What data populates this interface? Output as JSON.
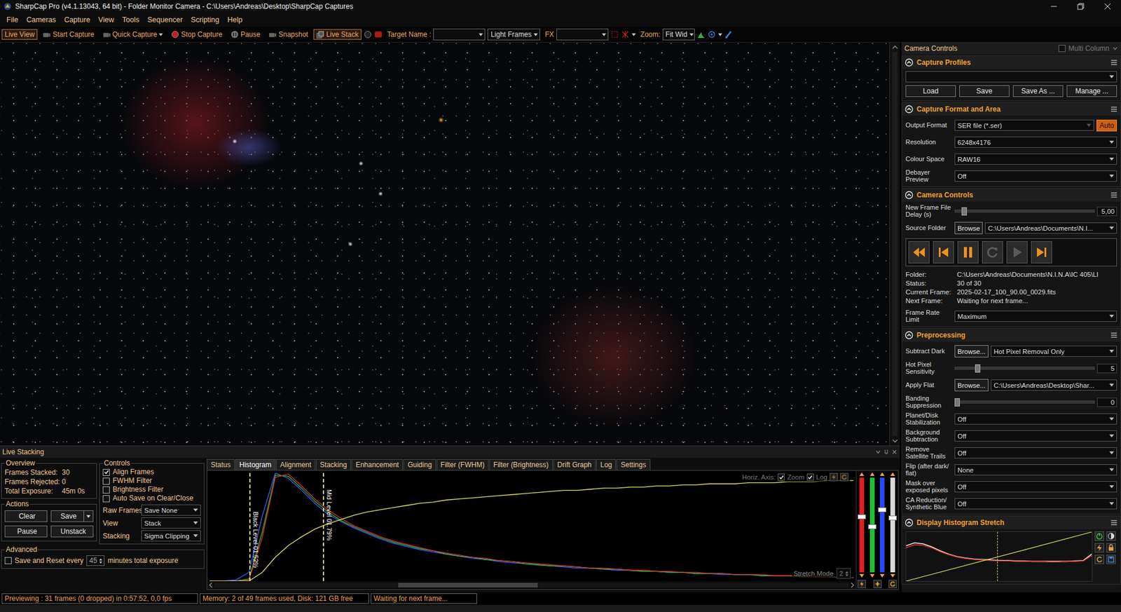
{
  "window": {
    "title": "SharpCap Pro (v4.1.13043, 64 bit) - Folder Monitor Camera - C:\\Users\\Andreas\\Desktop\\SharpCap Captures"
  },
  "menu": [
    "File",
    "Cameras",
    "Capture",
    "View",
    "Tools",
    "Sequencer",
    "Scripting",
    "Help"
  ],
  "toolbar": {
    "buttons": [
      {
        "label": "Live View",
        "selected": true,
        "dropdown": false
      },
      {
        "label": "Start Capture",
        "selected": false,
        "dropdown": false
      },
      {
        "label": "Quick Capture",
        "selected": false,
        "dropdown": true
      },
      {
        "label": "Stop Capture",
        "selected": false,
        "dropdown": false
      },
      {
        "label": "Pause",
        "selected": false,
        "dropdown": false
      },
      {
        "label": "Snapshot",
        "selected": false,
        "dropdown": false
      },
      {
        "label": "Live Stack",
        "selected": true,
        "dropdown": false
      }
    ],
    "target_name": {
      "label": "Target Name :",
      "value": ""
    },
    "frame_type": {
      "value": "Light Frames"
    },
    "fx": {
      "label": "FX",
      "value": ""
    },
    "zoom": {
      "label": "Zoom:",
      "value": "Fit Wid"
    }
  },
  "right_panel": {
    "title": "Camera Controls",
    "multi_column": {
      "label": "Multi Column",
      "checked": false
    },
    "capture_profiles": {
      "title": "Capture Profiles",
      "expanded": true,
      "profile": "",
      "buttons": [
        "Load",
        "Save",
        "Save As ...",
        "Manage ..."
      ]
    },
    "capture_format": {
      "title": "Capture Format and Area",
      "expanded": true,
      "rows": [
        {
          "label": "Output Format",
          "value": "SER file (*.ser)",
          "disabled": true,
          "extra": "Auto"
        },
        {
          "label": "Resolution",
          "value": "6248x4176",
          "disabled": false,
          "extra": ""
        },
        {
          "label": "Colour Space",
          "value": "RAW16",
          "disabled": false,
          "extra": ""
        },
        {
          "label": "Debayer Preview",
          "value": "Off",
          "disabled": false,
          "extra": ""
        }
      ]
    },
    "camera_controls": {
      "title": "Camera Controls",
      "expanded": true,
      "delay": {
        "label": "New Frame File Delay (s)",
        "level": 0.05,
        "value": "5,00"
      },
      "source_folder": {
        "label": "Source Folder",
        "button": "Browse",
        "value": "C:\\Users\\Andreas\\Documents\\N.I..."
      },
      "media_buttons": [
        {
          "disabled": false
        },
        {
          "disabled": false
        },
        {
          "disabled": false
        },
        {
          "disabled": true
        },
        {
          "disabled": true
        },
        {
          "disabled": false
        }
      ],
      "info": [
        {
          "label": "Folder:",
          "value": "C:\\Users\\Andreas\\Documents\\N.I.N.A\\IC 405\\LI"
        },
        {
          "label": "Status:",
          "value": "30 of 30"
        },
        {
          "label": "Current Frame:",
          "value": "2025-02-17_100_90.00_0029.fits"
        },
        {
          "label": "Next Frame:",
          "value": "Waiting for next frame..."
        }
      ],
      "frame_rate": {
        "label": "Frame Rate Limit",
        "value": "Maximum"
      }
    },
    "preprocessing": {
      "title": "Preprocessing",
      "expanded": true,
      "rows": [
        {
          "kind": "browse",
          "label": "Subtract Dark",
          "button": "Browse...",
          "value": "Hot Pixel Removal Only"
        },
        {
          "kind": "slider",
          "label": "Hot Pixel Sensitivity",
          "level": 0.15,
          "value": "5"
        },
        {
          "kind": "browse",
          "label": "Apply Flat",
          "button": "Browse...",
          "value": "C:\\Users\\Andreas\\Desktop\\Shar..."
        },
        {
          "kind": "slider",
          "label": "Banding Suppression",
          "level": 0,
          "value": "0"
        },
        {
          "kind": "select",
          "label": "Planet/Disk Stabilization",
          "value": "Off"
        },
        {
          "kind": "select",
          "label": "Background Subtraction",
          "value": "Off"
        },
        {
          "kind": "select",
          "label": "Remove Satellite Trails",
          "value": "Off"
        },
        {
          "kind": "select",
          "label": "Flip (after dark/ flat)",
          "value": "None"
        },
        {
          "kind": "select",
          "label": "Mask over exposed pixels",
          "value": "Off"
        },
        {
          "kind": "select",
          "label": "CA Reduction/ Synthetic Blue",
          "value": "Off"
        }
      ]
    },
    "display_stretch": {
      "title": "Display Histogram Stretch",
      "expanded": true,
      "series": [
        {
          "name": "Luminance",
          "color": "#f0f0f0",
          "values": [
            72,
            78,
            76,
            70,
            62,
            55,
            50,
            47,
            45,
            44,
            43,
            42,
            42,
            41,
            41,
            40,
            40,
            40,
            40,
            40,
            41,
            42,
            55
          ]
        },
        {
          "name": "Red",
          "color": "#e03030",
          "values": [
            68,
            74,
            73,
            68,
            60,
            54,
            49,
            46,
            44,
            43,
            42,
            41,
            41,
            40,
            40,
            40,
            40,
            39,
            39,
            40,
            40,
            41,
            52
          ]
        }
      ],
      "transfer": [
        0,
        100
      ],
      "mid_marker": {
        "level": 0.49
      }
    }
  },
  "live_stacking": {
    "title": "Live Stacking",
    "overview": {
      "title": "Overview",
      "items": [
        {
          "label": "Frames Stacked:",
          "value": "30"
        },
        {
          "label": "Frames Rejected:",
          "value": "0"
        },
        {
          "label": "Total Exposure:",
          "value": "45m 0s"
        }
      ]
    },
    "actions": {
      "title": "Actions",
      "buttons": [
        {
          "label": "Clear",
          "dropdown": false
        },
        {
          "label": "Save",
          "dropdown": true
        },
        {
          "label": "Pause",
          "dropdown": false
        },
        {
          "label": "Unstack",
          "dropdown": false
        }
      ]
    },
    "advanced": {
      "title": "Advanced",
      "label": "Save and Reset every",
      "checked": false,
      "value": "45",
      "suffix": "minutes total exposure"
    },
    "controls": {
      "title": "Controls",
      "checkboxes": [
        {
          "label": "Align Frames",
          "checked": true
        },
        {
          "label": "FWHM Filter",
          "checked": false
        },
        {
          "label": "Brightness Filter",
          "checked": false
        },
        {
          "label": "Auto Save on Clear/Close",
          "checked": false
        }
      ],
      "selects": [
        {
          "label": "Raw Frames",
          "value": "Save None"
        },
        {
          "label": "View",
          "value": "Stack"
        },
        {
          "label": "Stacking",
          "value": "Sigma Clipping"
        }
      ]
    },
    "tabs": [
      {
        "label": "Status",
        "selected": false
      },
      {
        "label": "Histogram",
        "selected": true
      },
      {
        "label": "Alignment",
        "selected": false
      },
      {
        "label": "Stacking",
        "selected": false
      },
      {
        "label": "Enhancement",
        "selected": false
      },
      {
        "label": "Guiding",
        "selected": false
      },
      {
        "label": "Filter (FWHM)",
        "selected": false
      },
      {
        "label": "Filter (Brightness)",
        "selected": false
      },
      {
        "label": "Drift Graph",
        "selected": false
      },
      {
        "label": "Log",
        "selected": false
      },
      {
        "label": "Settings",
        "selected": false
      }
    ],
    "histogram": {
      "horizontal_axis": {
        "label": "Horiz. Axis:",
        "zoom": {
          "label": "Zoom",
          "checked": true
        },
        "log": {
          "label": "Log",
          "checked": true
        }
      },
      "black_level": {
        "label": "Black Level 01.52%",
        "level": 0.065
      },
      "mid_level": {
        "label": "Mid Level 01.79%",
        "level": 0.178
      },
      "stretch_mode": {
        "label": "Stretch Mode",
        "value": "2"
      },
      "series": [
        {
          "name": "Blue",
          "color": "#4060ff",
          "values": [
            0,
            0,
            1,
            8,
            60,
            100,
            95,
            84,
            72,
            62,
            55,
            49,
            44,
            39,
            35,
            32,
            29,
            27,
            25,
            23,
            21,
            20,
            18,
            17,
            16,
            15,
            14,
            13,
            12,
            12,
            11,
            10,
            10,
            9,
            9,
            8,
            8,
            7,
            7,
            6,
            6,
            6,
            5,
            5,
            5,
            4,
            4,
            4,
            3,
            3
          ]
        },
        {
          "name": "Green",
          "color": "#30c040",
          "values": [
            0,
            0,
            0,
            2,
            45,
            98,
            97,
            86,
            74,
            64,
            56,
            50,
            45,
            40,
            36,
            33,
            30,
            28,
            25,
            23,
            22,
            20,
            19,
            18,
            16,
            15,
            14,
            14,
            13,
            12,
            11,
            11,
            10,
            9,
            9,
            8,
            8,
            7,
            7,
            7,
            6,
            6,
            5,
            5,
            5,
            4,
            4,
            4,
            3,
            3
          ]
        },
        {
          "name": "Red",
          "color": "#e03030",
          "values": [
            0,
            0,
            0,
            1,
            40,
            96,
            99,
            88,
            76,
            66,
            58,
            51,
            46,
            41,
            37,
            34,
            31,
            28,
            26,
            24,
            22,
            21,
            19,
            18,
            17,
            16,
            15,
            14,
            13,
            12,
            12,
            11,
            10,
            10,
            9,
            9,
            8,
            8,
            7,
            7,
            6,
            6,
            6,
            5,
            5,
            5,
            4,
            4,
            4,
            3
          ]
        }
      ],
      "curve": {
        "name": "Stretch",
        "color": "#e8e860",
        "values": [
          0,
          0,
          0,
          0,
          8,
          22,
          33,
          41,
          48,
          53,
          57,
          61,
          64,
          66,
          68,
          70,
          72,
          73,
          75,
          76,
          77,
          78,
          79,
          80,
          81,
          82,
          83,
          84,
          84,
          85,
          86,
          86,
          87,
          87,
          88,
          88,
          89,
          89,
          90,
          90,
          90,
          91,
          91,
          91,
          92,
          92,
          92,
          93,
          93,
          93
        ]
      },
      "sliders": [
        {
          "color": "#e02020",
          "level": 0.59
        },
        {
          "color": "#20c030",
          "level": 0.48
        },
        {
          "color": "#2848ff",
          "level": 0.67
        },
        {
          "color": "#d8d8d8",
          "level": 0.58
        }
      ],
      "h_scroll": {
        "start": 0.29,
        "size": 0.22
      }
    }
  },
  "status_bar": [
    "Previewing : 31 frames (0 dropped) in 0:57:52, 0,0 fps",
    "Memory: 2 of 49 frames used, Disk: 121 GB free",
    "Waiting for next frame..."
  ]
}
